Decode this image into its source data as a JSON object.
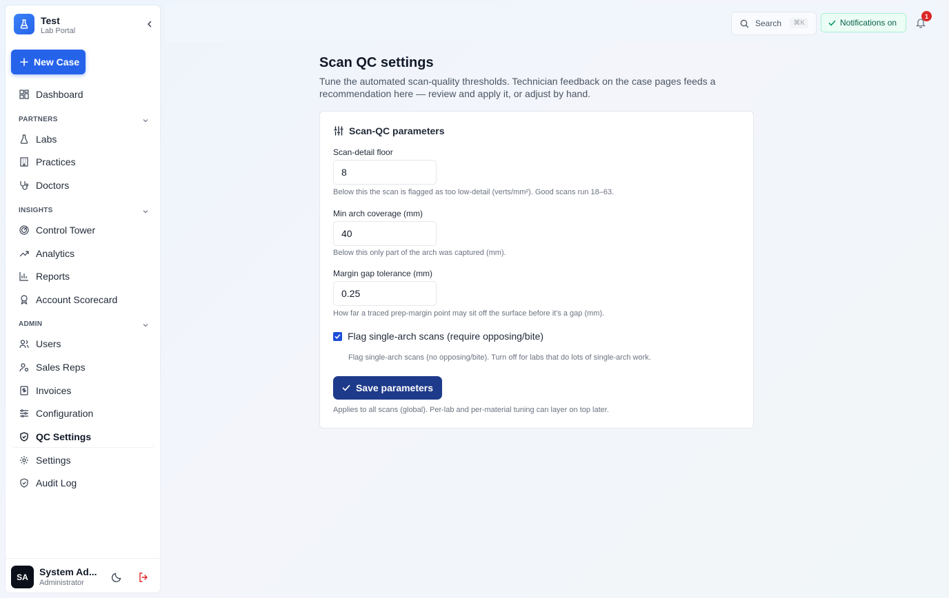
{
  "brand": {
    "name": "Test",
    "subtitle": "Lab Portal"
  },
  "sidebar": {
    "new_case_label": "New Case",
    "dashboard": "Dashboard",
    "sections": [
      {
        "title": "PARTNERS",
        "items": [
          "Labs",
          "Practices",
          "Doctors"
        ]
      },
      {
        "title": "INSIGHTS",
        "items": [
          "Control Tower",
          "Analytics",
          "Reports",
          "Account Scorecard"
        ]
      },
      {
        "title": "ADMIN",
        "items": [
          "Users",
          "Sales Reps",
          "Invoices",
          "Configuration",
          "QC Settings",
          "Settings",
          "Audit Log"
        ]
      }
    ],
    "active_item": "QC Settings",
    "user": {
      "initials": "SA",
      "name": "System Ad...",
      "role": "Administrator"
    }
  },
  "header": {
    "search_label": "Search",
    "search_shortcut": "⌘K",
    "notifications_label": "Notifications on",
    "notification_count": "1"
  },
  "main": {
    "title": "Scan QC settings",
    "description": "Tune the automated scan-quality thresholds. Technician feedback on the case pages feeds a recommendation here — review and apply it, or adjust by hand.",
    "card_title": "Scan-QC parameters",
    "fields": [
      {
        "label": "Scan-detail floor",
        "value": "8",
        "help": "Below this the scan is flagged as too low-detail (verts/mm²). Good scans run 18–63."
      },
      {
        "label": "Min arch coverage (mm)",
        "value": "40",
        "help": "Below this only part of the arch was captured (mm)."
      },
      {
        "label": "Margin gap tolerance (mm)",
        "value": "0.25",
        "help": "How far a traced prep-margin point may sit off the surface before it's a gap (mm)."
      }
    ],
    "checkbox": {
      "label": "Flag single-arch scans (require opposing/bite)",
      "checked": true,
      "help": "Flag single-arch scans (no opposing/bite). Turn off for labs that do lots of single-arch work."
    },
    "save_label": "Save parameters",
    "footnote": "Applies to all scans (global). Per-lab and per-material tuning can layer on top later."
  },
  "colors": {
    "primary": "#2563eb",
    "save_button": "#1e3a8a",
    "notif_green": "#065f46",
    "badge_red": "#dc2626"
  }
}
